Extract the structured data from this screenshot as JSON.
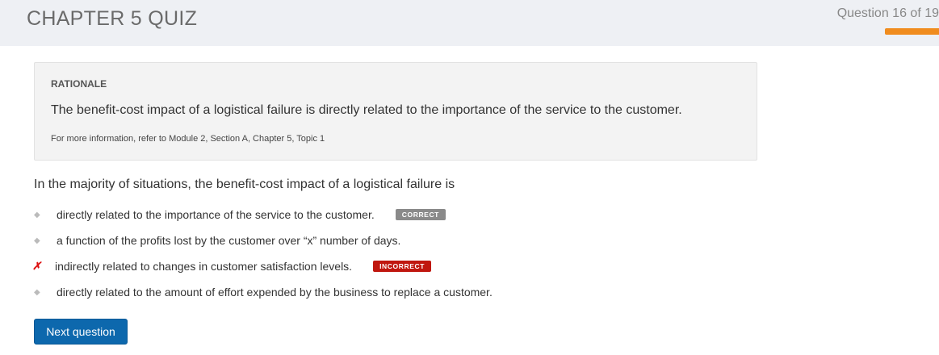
{
  "header": {
    "title": "CHAPTER 5 QUIZ",
    "question_counter": "Question 16 of 19",
    "progress_fraction": 0.842,
    "accent_color": "#f08c1e"
  },
  "rationale": {
    "label": "RATIONALE",
    "text": "The benefit-cost impact of a logistical failure is directly related to the importance of the service to the customer.",
    "more_info": "For more information, refer to Module 2, Section A, Chapter 5, Topic 1"
  },
  "question": "In the majority of situations, the benefit-cost impact of a logistical failure is",
  "options": [
    {
      "text": "directly related to the importance of the service to the customer.",
      "badge": "CORRECT"
    },
    {
      "text": "a function of the profits lost by the customer over “x” number of days."
    },
    {
      "text": "indirectly related to changes in customer satisfaction levels.",
      "badge": "INCORRECT",
      "marker": "✗"
    },
    {
      "text": "directly related to the amount of effort expended by the business to replace a customer."
    }
  ],
  "next_button": "Next question"
}
